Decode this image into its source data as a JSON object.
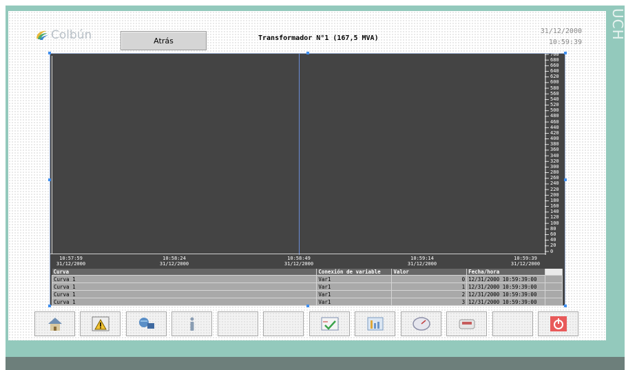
{
  "side_label": "UCH",
  "header": {
    "logo_text": "Colbún",
    "back_button": "Atrás",
    "title": "Transformador N°1 (167,5 MVA)",
    "date": "31/12/2000",
    "time": "10:59:39"
  },
  "trend": {
    "y_ticks": [
      "700",
      "680",
      "660",
      "640",
      "620",
      "600",
      "580",
      "560",
      "540",
      "520",
      "500",
      "480",
      "460",
      "440",
      "420",
      "400",
      "380",
      "360",
      "340",
      "320",
      "300",
      "280",
      "260",
      "240",
      "220",
      "200",
      "180",
      "160",
      "140",
      "120",
      "100",
      "80",
      "60",
      "40",
      "20",
      "0"
    ],
    "x_ticks": [
      {
        "time": "10:57:59",
        "date": "31/12/2000"
      },
      {
        "time": "10:58:24",
        "date": "31/12/2000"
      },
      {
        "time": "10:58:49",
        "date": "31/12/2000"
      },
      {
        "time": "10:59:14",
        "date": "31/12/2000"
      },
      {
        "time": "10:59:39",
        "date": "31/12/2000"
      }
    ]
  },
  "legend": {
    "columns": [
      "Curva",
      "Conexión de variable",
      "Valor",
      "Fecha/hora"
    ],
    "rows": [
      {
        "curva": "Curva 1",
        "conexion": "Var1",
        "valor": "0",
        "fecha": "12/31/2000 10:59:39:00"
      },
      {
        "curva": "Curva 1",
        "conexion": "Var1",
        "valor": "1",
        "fecha": "12/31/2000 10:59:39:00"
      },
      {
        "curva": "Curva 1",
        "conexion": "Var1",
        "valor": "2",
        "fecha": "12/31/2000 10:59:39:00"
      },
      {
        "curva": "Curva 1",
        "conexion": "Var1",
        "valor": "3",
        "fecha": "12/31/2000 10:59:39:00"
      }
    ]
  },
  "toolbar": {
    "buttons": [
      "home-icon",
      "alarm-warning-icon",
      "network-icon",
      "info-icon",
      "",
      "",
      "trend-check-icon",
      "bar-chart-icon",
      "gauge-icon",
      "print-icon",
      "",
      "power-icon"
    ]
  },
  "colors": {
    "frame": "#93c9bc",
    "trend_bg": "#444444",
    "cursor": "#6b8ed8",
    "power_button": "#e85a5a"
  }
}
